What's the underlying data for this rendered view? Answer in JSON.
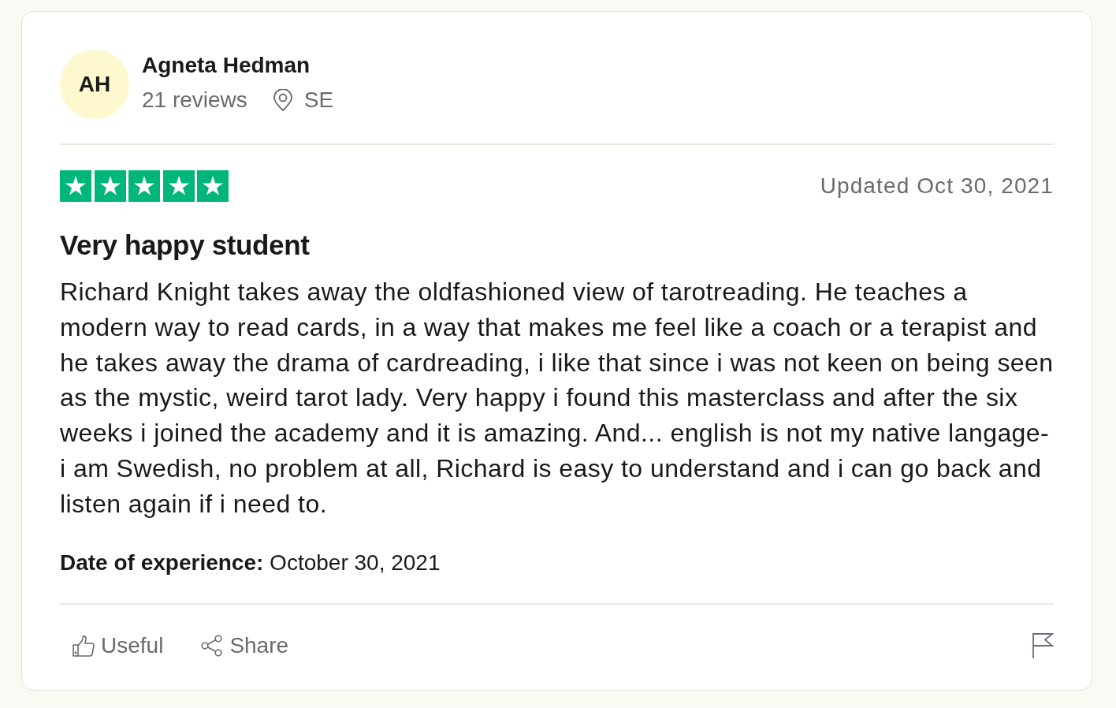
{
  "reviewer": {
    "initials": "AH",
    "name": "Agneta Hedman",
    "review_count": "21 reviews",
    "country": "SE"
  },
  "review": {
    "stars": 5,
    "updated": "Updated Oct 30, 2021",
    "title": "Very happy student",
    "body": "Richard Knight takes away the oldfashioned view of tarotreading. He teaches a modern way to read cards, in a way that makes me feel like a coach or a terapist and he takes away the drama of cardreading, i like that since i was not keen on being seen as the mystic, weird tarot lady. Very happy i found this masterclass and after the six weeks i joined the academy and it is amazing. And... english is not my native langage- i am Swedish, no problem at all, Richard is easy to understand and i can go back and listen again if i need to.",
    "date_of_experience": "**Date of experience:** October 30, 2021"
  },
  "actions": [
    {
      "kind": "useful",
      "label": "Useful"
    },
    {
      "kind": "share",
      "label": "Share"
    }
  ]
}
